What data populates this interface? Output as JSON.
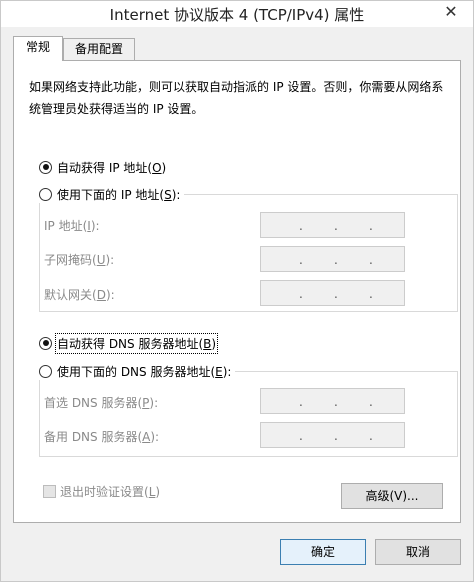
{
  "window": {
    "title": "Internet 协议版本 4 (TCP/IPv4) 属性",
    "close_glyph": "✕"
  },
  "tabs": [
    {
      "label": "常规"
    },
    {
      "label": "备用配置"
    }
  ],
  "description": "如果网络支持此功能，则可以获取自动指派的 IP 设置。否则，你需要从网络系统管理员处获得适当的 IP 设置。",
  "ip": {
    "auto": {
      "label": "自动获得 IP 地址(",
      "key": "O",
      "tail": ")"
    },
    "manual": {
      "label": "使用下面的 IP 地址(",
      "key": "S",
      "tail": "):"
    },
    "fields": [
      {
        "label": "IP 地址(",
        "key": "I",
        "tail": "):"
      },
      {
        "label": "子网掩码(",
        "key": "U",
        "tail": "):"
      },
      {
        "label": "默认网关(",
        "key": "D",
        "tail": "):"
      }
    ]
  },
  "dns": {
    "auto": {
      "label": "自动获得 DNS 服务器地址(",
      "key": "B",
      "tail": ")"
    },
    "manual": {
      "label": "使用下面的 DNS 服务器地址(",
      "key": "E",
      "tail": "):"
    },
    "fields": [
      {
        "label": "首选 DNS 服务器(",
        "key": "P",
        "tail": "):"
      },
      {
        "label": "备用 DNS 服务器(",
        "key": "A",
        "tail": "):"
      }
    ]
  },
  "validate": {
    "label": "退出时验证设置(",
    "key": "L",
    "tail": ")"
  },
  "buttons": {
    "advanced": "高级(V)...",
    "ok": "确定",
    "cancel": "取消"
  },
  "ip_dot": "."
}
